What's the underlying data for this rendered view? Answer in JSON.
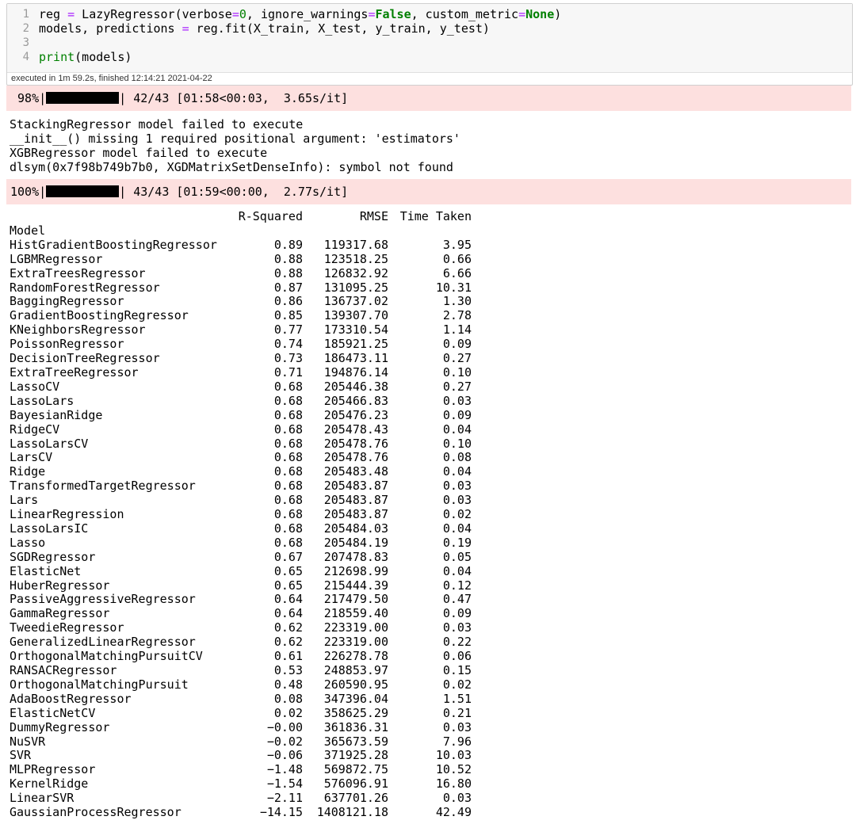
{
  "cell": {
    "line_numbers": [
      "1",
      "2",
      "3",
      "4"
    ],
    "code": {
      "l1_a": "reg ",
      "l1_eq": "=",
      "l1_b": " LazyRegressor(verbose",
      "l1_eq2": "=",
      "l1_num": "0",
      "l1_c": ", ignore_warnings",
      "l1_eq3": "=",
      "l1_false": "False",
      "l1_d": ", custom_metric",
      "l1_eq4": "=",
      "l1_none": "None",
      "l1_e": ")",
      "l2_a": "models, predictions ",
      "l2_eq": "=",
      "l2_b": " reg.fit(X_train, X_test, y_train, y_test)",
      "l4_print": "print",
      "l4_b": "(models)"
    },
    "execution_info": "executed in 1m 59.2s, finished 12:14:21 2021-04-22"
  },
  "progress_1": {
    "percent_label": "98%|",
    "fraction": 0.98,
    "rest": "| 42/43 [01:58<00:03,  3.65s/it]"
  },
  "progress_2": {
    "percent_label": "100%|",
    "fraction": 1.0,
    "rest": "| 43/43 [01:59<00:00,  2.77s/it]"
  },
  "stderr_lines": [
    "StackingRegressor model failed to execute",
    "__init__() missing 1 required positional argument: 'estimators'",
    "XGBRegressor model failed to execute",
    "dlsym(0x7f98b749b7b0, XGDMatrixSetDenseInfo): symbol not found"
  ],
  "results": {
    "index_name": "Model",
    "columns": [
      "R-Squared",
      "RMSE",
      "Time Taken"
    ],
    "rows": [
      [
        "HistGradientBoostingRegressor",
        "0.89",
        "119317.68",
        "3.95"
      ],
      [
        "LGBMRegressor",
        "0.88",
        "123518.25",
        "0.66"
      ],
      [
        "ExtraTreesRegressor",
        "0.88",
        "126832.92",
        "6.66"
      ],
      [
        "RandomForestRegressor",
        "0.87",
        "131095.25",
        "10.31"
      ],
      [
        "BaggingRegressor",
        "0.86",
        "136737.02",
        "1.30"
      ],
      [
        "GradientBoostingRegressor",
        "0.85",
        "139307.70",
        "2.78"
      ],
      [
        "KNeighborsRegressor",
        "0.77",
        "173310.54",
        "1.14"
      ],
      [
        "PoissonRegressor",
        "0.74",
        "185921.25",
        "0.09"
      ],
      [
        "DecisionTreeRegressor",
        "0.73",
        "186473.11",
        "0.27"
      ],
      [
        "ExtraTreeRegressor",
        "0.71",
        "194876.14",
        "0.10"
      ],
      [
        "LassoCV",
        "0.68",
        "205446.38",
        "0.27"
      ],
      [
        "LassoLars",
        "0.68",
        "205466.83",
        "0.03"
      ],
      [
        "BayesianRidge",
        "0.68",
        "205476.23",
        "0.09"
      ],
      [
        "RidgeCV",
        "0.68",
        "205478.43",
        "0.04"
      ],
      [
        "LassoLarsCV",
        "0.68",
        "205478.76",
        "0.10"
      ],
      [
        "LarsCV",
        "0.68",
        "205478.76",
        "0.08"
      ],
      [
        "Ridge",
        "0.68",
        "205483.48",
        "0.04"
      ],
      [
        "TransformedTargetRegressor",
        "0.68",
        "205483.87",
        "0.03"
      ],
      [
        "Lars",
        "0.68",
        "205483.87",
        "0.03"
      ],
      [
        "LinearRegression",
        "0.68",
        "205483.87",
        "0.02"
      ],
      [
        "LassoLarsIC",
        "0.68",
        "205484.03",
        "0.04"
      ],
      [
        "Lasso",
        "0.68",
        "205484.19",
        "0.19"
      ],
      [
        "SGDRegressor",
        "0.67",
        "207478.83",
        "0.05"
      ],
      [
        "ElasticNet",
        "0.65",
        "212698.99",
        "0.04"
      ],
      [
        "HuberRegressor",
        "0.65",
        "215444.39",
        "0.12"
      ],
      [
        "PassiveAggressiveRegressor",
        "0.64",
        "217479.50",
        "0.47"
      ],
      [
        "GammaRegressor",
        "0.64",
        "218559.40",
        "0.09"
      ],
      [
        "TweedieRegressor",
        "0.62",
        "223319.00",
        "0.03"
      ],
      [
        "GeneralizedLinearRegressor",
        "0.62",
        "223319.00",
        "0.22"
      ],
      [
        "OrthogonalMatchingPursuitCV",
        "0.61",
        "226278.78",
        "0.06"
      ],
      [
        "RANSACRegressor",
        "0.53",
        "248853.97",
        "0.15"
      ],
      [
        "OrthogonalMatchingPursuit",
        "0.48",
        "260590.95",
        "0.02"
      ],
      [
        "AdaBoostRegressor",
        "0.08",
        "347396.04",
        "1.51"
      ],
      [
        "ElasticNetCV",
        "0.02",
        "358625.29",
        "0.21"
      ],
      [
        "DummyRegressor",
        "−0.00",
        "361836.31",
        "0.03"
      ],
      [
        "NuSVR",
        "−0.02",
        "365673.59",
        "7.96"
      ],
      [
        "SVR",
        "−0.06",
        "371925.28",
        "10.03"
      ],
      [
        "MLPRegressor",
        "−1.48",
        "569872.75",
        "10.52"
      ],
      [
        "KernelRidge",
        "−1.54",
        "576096.91",
        "16.80"
      ],
      [
        "LinearSVR",
        "−2.11",
        "637701.26",
        "0.03"
      ],
      [
        "GaussianProcessRegressor",
        "−14.15",
        "1408121.18",
        "42.49"
      ]
    ]
  }
}
